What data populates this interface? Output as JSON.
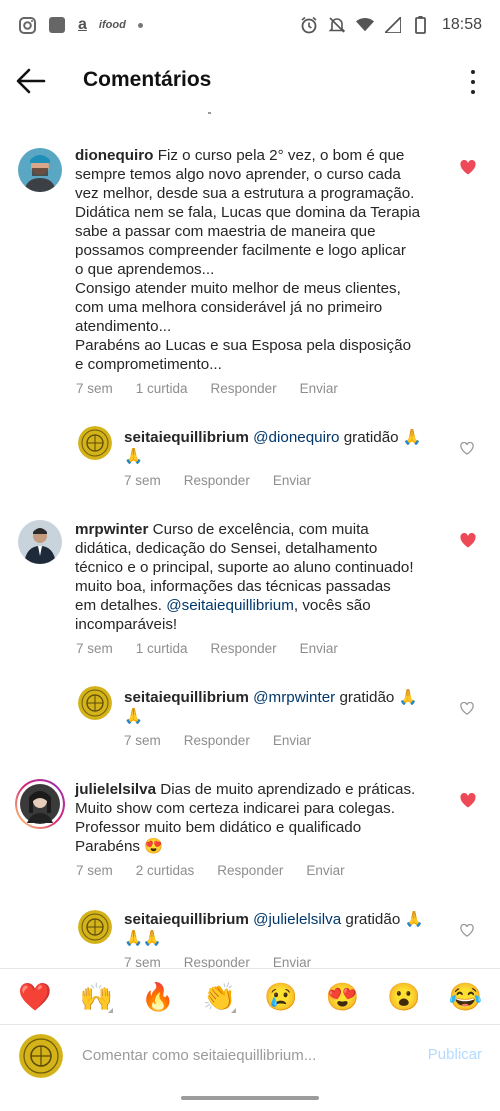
{
  "status_bar": {
    "time": "18:58",
    "left_icons": [
      "instagram-icon",
      "app-icon",
      "amazon-icon",
      "ifood-icon",
      "dot-icon"
    ],
    "amazon_letter": "a",
    "ifood_label": "ifood",
    "right_icons": [
      "alarm-icon",
      "mute-icon",
      "wifi-icon",
      "signal-icon",
      "battery-icon"
    ]
  },
  "header": {
    "title": "Comentários"
  },
  "comments": [
    {
      "user": "dionequiro",
      "text": "Fiz o curso pela 2° vez, o bom é que\nsempre temos algo novo aprender, o curso cada\nvez melhor, desde sua a estrutura a programação.\nDidática nem se fala, Lucas que domina da Terapia\nsabe a passar com maestria de maneira que\npossamos compreender facilmente e logo aplicar\no que aprendemos...\nConsigo atender muito melhor de meus clientes,\ncom uma melhora considerável já no primeiro\natendimento...\nParabéns ao Lucas e sua Esposa pela disposição\ne comprometimento...",
      "time": "7 sem",
      "likes": "1 curtida",
      "reply": "Responder",
      "send": "Enviar",
      "liked": true
    },
    {
      "user": "seitaiequillibrium",
      "mention": "@dionequiro",
      "text": " gratidão 🙏\n🙏",
      "time": "7 sem",
      "reply": "Responder",
      "send": "Enviar",
      "liked": false
    },
    {
      "user": "mrpwinter",
      "text": "Curso de excelência, com muita\ndidática, dedicação do Sensei, detalhamento\ntécnico e o principal, suporte ao aluno continuado!\nmuito boa, informações das técnicas passadas\nem detalhes. ",
      "mention": "@seitaiequillibrium",
      "text_after": ", vocês são\nincomparáveis!",
      "time": "7 sem",
      "likes": "1 curtida",
      "reply": "Responder",
      "send": "Enviar",
      "liked": true
    },
    {
      "user": "seitaiequillibrium",
      "mention": "@mrpwinter",
      "text": " gratidão 🙏\n🙏",
      "time": "7 sem",
      "reply": "Responder",
      "send": "Enviar",
      "liked": false
    },
    {
      "user": "julielelsilva",
      "text": "Dias de muito aprendizado e práticas.\nMuito show com certeza indicarei para colegas.\nProfessor muito bem didático e qualificado\nParabéns 😍",
      "time": "7 sem",
      "likes": "2 curtidas",
      "reply": "Responder",
      "send": "Enviar",
      "liked": true
    },
    {
      "user": "seitaiequillibrium",
      "mention": "@julielelsilva",
      "text": " gratidão 🙏\n🙏🙏",
      "time": "7 sem",
      "reply": "Responder",
      "send": "Enviar",
      "liked": false
    }
  ],
  "reactions": [
    "❤️",
    "🙌",
    "🔥",
    "👏",
    "😢",
    "😍",
    "😮",
    "😂"
  ],
  "composer": {
    "placeholder": "Comentar como seitaiequillibrium...",
    "publish": "Publicar"
  },
  "colors": {
    "like_red": "#ed4956",
    "mention_blue": "#00376b",
    "meta_gray": "#8e8e8e",
    "publish_blue": "#b3dbff"
  }
}
